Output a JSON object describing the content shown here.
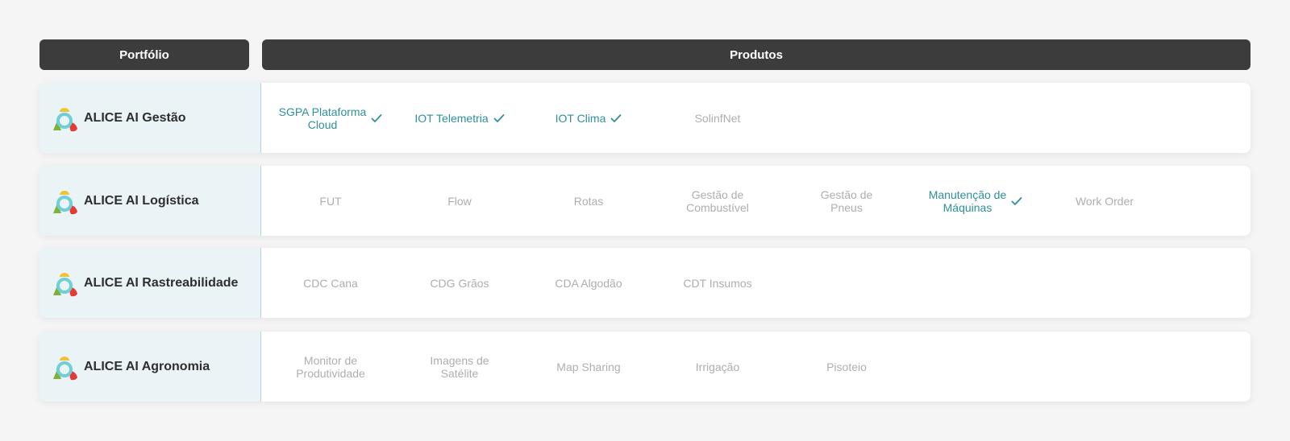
{
  "header": {
    "portfolio_label": "Portfólio",
    "products_label": "Produtos"
  },
  "colors": {
    "header_bg": "#3c3c3c",
    "active_text": "#2f8f9c",
    "inactive_text": "#aeaeae",
    "portfolio_cell_bg": "#eaf4f7"
  },
  "rows": [
    {
      "portfolio": "ALICE AI Gestão",
      "products": [
        {
          "line1": "SGPA Plataforma",
          "line2": "Cloud",
          "active": true
        },
        {
          "line1": "IOT Telemetria",
          "line2": "",
          "active": true
        },
        {
          "line1": "IOT Clima",
          "line2": "",
          "active": true
        },
        {
          "line1": "SolinfNet",
          "line2": "",
          "active": false
        }
      ]
    },
    {
      "portfolio": "ALICE AI Logística",
      "products": [
        {
          "line1": "FUT",
          "line2": "",
          "active": false
        },
        {
          "line1": "Flow",
          "line2": "",
          "active": false
        },
        {
          "line1": "Rotas",
          "line2": "",
          "active": false
        },
        {
          "line1": "Gestão de",
          "line2": "Combustível",
          "active": false
        },
        {
          "line1": "Gestão de",
          "line2": "Pneus",
          "active": false
        },
        {
          "line1": "Manutenção de",
          "line2": "Máquinas",
          "active": true
        },
        {
          "line1": "Work Order",
          "line2": "",
          "active": false
        }
      ]
    },
    {
      "portfolio": "ALICE AI Rastreabilidade",
      "products": [
        {
          "line1": "CDC Cana",
          "line2": "",
          "active": false
        },
        {
          "line1": "CDG Grãos",
          "line2": "",
          "active": false
        },
        {
          "line1": "CDA Algodão",
          "line2": "",
          "active": false
        },
        {
          "line1": "CDT Insumos",
          "line2": "",
          "active": false
        }
      ]
    },
    {
      "portfolio": "ALICE AI Agronomia",
      "products": [
        {
          "line1": "Monitor de",
          "line2": "Produtividade",
          "active": false
        },
        {
          "line1": "Imagens de",
          "line2": "Satélite",
          "active": false
        },
        {
          "line1": "Map Sharing",
          "line2": "",
          "active": false
        },
        {
          "line1": "Irrigação",
          "line2": "",
          "active": false
        },
        {
          "line1": "Pisoteio",
          "line2": "",
          "active": false
        }
      ]
    }
  ],
  "icons": {
    "logo": "alice-logo-icon",
    "check": "check-icon"
  }
}
